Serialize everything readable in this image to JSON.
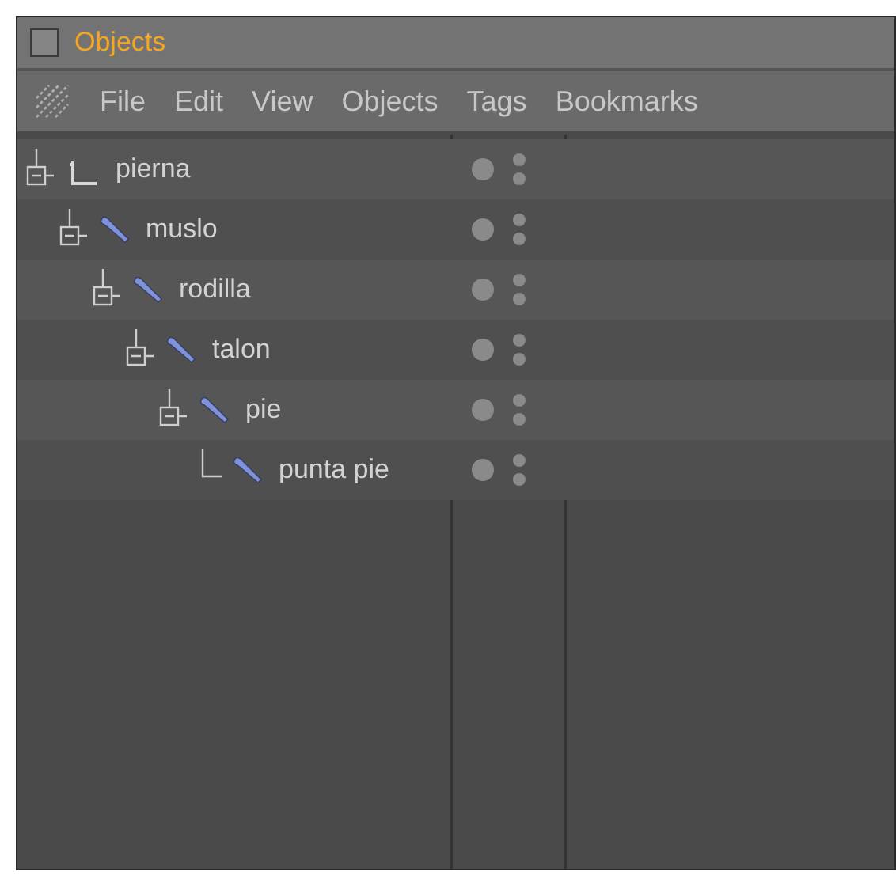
{
  "panel": {
    "title": "Objects"
  },
  "menu": [
    "File",
    "Edit",
    "View",
    "Objects",
    "Tags",
    "Bookmarks"
  ],
  "tree": [
    {
      "name": "pierna",
      "kind": "null",
      "expanded": true,
      "children": [
        {
          "name": "muslo",
          "kind": "bone",
          "expanded": true,
          "children": [
            {
              "name": "rodilla",
              "kind": "bone",
              "expanded": true,
              "children": [
                {
                  "name": "talon",
                  "kind": "bone",
                  "expanded": true,
                  "children": [
                    {
                      "name": "pie",
                      "kind": "bone",
                      "expanded": true,
                      "children": [
                        {
                          "name": "punta pie",
                          "kind": "bone"
                        }
                      ]
                    }
                  ]
                }
              ]
            }
          ]
        }
      ]
    }
  ]
}
